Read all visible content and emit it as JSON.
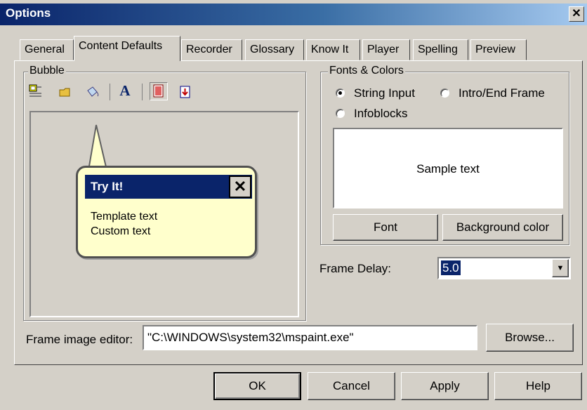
{
  "window": {
    "title": "Options",
    "close_glyph": "✕"
  },
  "tabs": [
    {
      "label": "General"
    },
    {
      "label": "Content Defaults"
    },
    {
      "label": "Recorder"
    },
    {
      "label": "Glossary"
    },
    {
      "label": "Know It"
    },
    {
      "label": "Player"
    },
    {
      "label": "Spelling"
    },
    {
      "label": "Preview"
    }
  ],
  "active_tab": "Content Defaults",
  "bubble": {
    "legend": "Bubble",
    "toolbar_icons": [
      "template-icon",
      "folder-icon",
      "paint-bucket-icon",
      "font-icon",
      "bubble-style-icon",
      "pointer-position-icon"
    ],
    "preview": {
      "title": "Try It!",
      "line1": "Template text",
      "line2": "Custom text",
      "close_glyph": "✕"
    }
  },
  "fonts_colors": {
    "legend": "Fonts & Colors",
    "options": [
      {
        "label": "String Input",
        "selected": true
      },
      {
        "label": "Intro/End Frame",
        "selected": false
      },
      {
        "label": "Infoblocks",
        "selected": false
      }
    ],
    "sample_text": "Sample text",
    "font_button": "Font",
    "background_button": "Background color"
  },
  "frame_delay": {
    "label": "Frame Delay:",
    "value": "5.0"
  },
  "frame_image_editor": {
    "label": "Frame image editor:",
    "value": "\"C:\\WINDOWS\\system32\\mspaint.exe\"",
    "browse_button": "Browse..."
  },
  "footer": {
    "ok": "OK",
    "cancel": "Cancel",
    "apply": "Apply",
    "help": "Help"
  },
  "colors": {
    "title_bar": "#0a246a",
    "bubble_header": "#0a246a",
    "bubble_fill": "#ffffcc",
    "dialog_bg": "#d4d0c8"
  }
}
